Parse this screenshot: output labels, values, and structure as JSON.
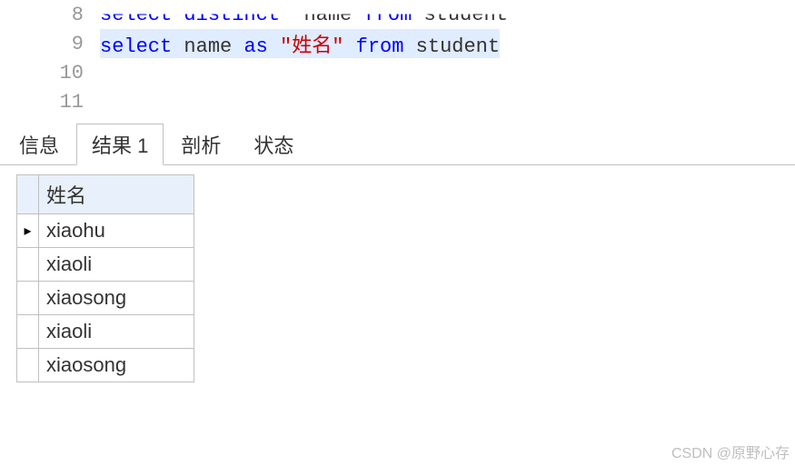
{
  "editor": {
    "lines": [
      {
        "num": "8",
        "tokens": [
          {
            "t": "select distinct",
            "cls": "kw"
          },
          {
            "t": "  name ",
            "cls": "plain"
          },
          {
            "t": "from",
            "cls": "kw"
          },
          {
            "t": " student",
            "cls": "plain"
          }
        ],
        "highlighted": false,
        "clipTop": true
      },
      {
        "num": "9",
        "tokens": [
          {
            "t": "select",
            "cls": "kw"
          },
          {
            "t": " name ",
            "cls": "plain"
          },
          {
            "t": "as",
            "cls": "kw"
          },
          {
            "t": " ",
            "cls": "plain"
          },
          {
            "t": "\"姓名\"",
            "cls": "str"
          },
          {
            "t": " ",
            "cls": "plain"
          },
          {
            "t": "from",
            "cls": "kw"
          },
          {
            "t": " student",
            "cls": "plain"
          }
        ],
        "highlighted": true,
        "clipTop": false
      },
      {
        "num": "10",
        "tokens": [],
        "highlighted": false,
        "clipTop": false
      },
      {
        "num": "11",
        "tokens": [],
        "highlighted": false,
        "clipTop": false
      }
    ]
  },
  "tabs": {
    "items": [
      {
        "label": "信息",
        "active": false
      },
      {
        "label": "结果 1",
        "active": true
      },
      {
        "label": "剖析",
        "active": false
      },
      {
        "label": "状态",
        "active": false
      }
    ]
  },
  "result": {
    "header": "姓名",
    "rows": [
      {
        "value": "xiaohu",
        "current": true
      },
      {
        "value": "xiaoli",
        "current": false
      },
      {
        "value": "xiaosong",
        "current": false
      },
      {
        "value": "xiaoli",
        "current": false
      },
      {
        "value": "xiaosong",
        "current": false
      }
    ]
  },
  "watermark": "CSDN @原野心存"
}
